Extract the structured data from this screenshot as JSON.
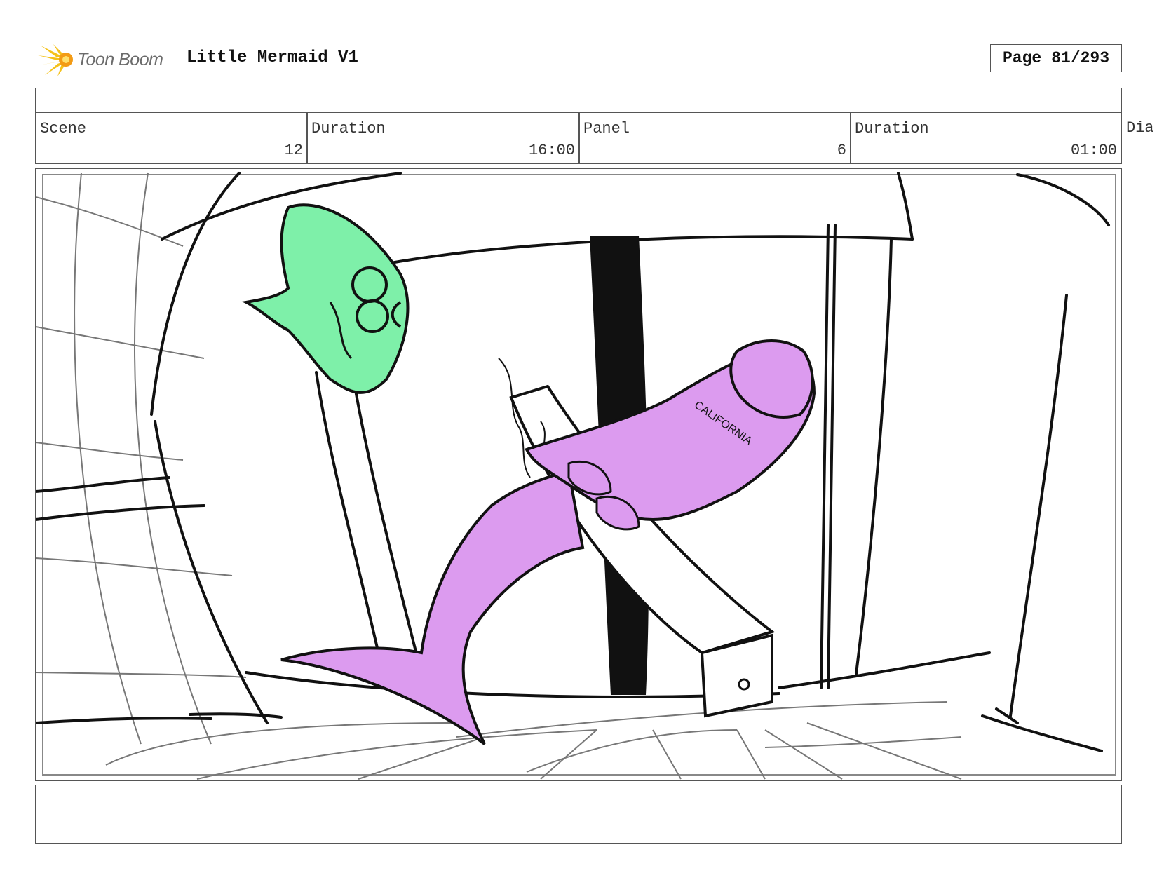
{
  "header": {
    "logo_text": "Toon Boom",
    "project_title": "Little Mermaid V1",
    "page_label": "Page",
    "page_value": "81/293"
  },
  "info": {
    "scene_label": "Scene",
    "scene_value": "12",
    "scene_duration_label": "Duration",
    "scene_duration_value": "16:00",
    "panel_label": "Panel",
    "panel_value": "6",
    "panel_duration_label": "Duration",
    "panel_duration_value": "01:00",
    "dialog_label": "Dia"
  },
  "panel_art": {
    "shirt_text": "CALIFORNIA",
    "colors": {
      "fish": "#7ef0a9",
      "mermaid": "#dc9bef",
      "ink": "#111111",
      "guide_lines": "#777777"
    }
  }
}
